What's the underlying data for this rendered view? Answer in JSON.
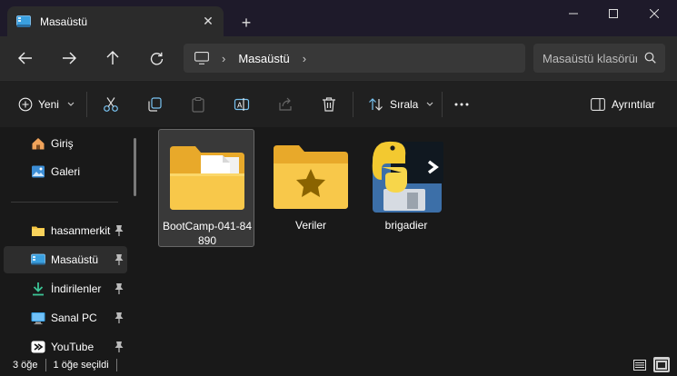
{
  "window": {
    "tab_title": "Masaüstü",
    "tab_close": "✕",
    "new_tab": "+"
  },
  "address": {
    "crumbs": [
      "Masaüstü"
    ]
  },
  "search": {
    "placeholder": "Masaüstü klasörünü ara"
  },
  "toolbar": {
    "new_label": "Yeni",
    "sort_label": "Sırala",
    "details_label": "Ayrıntılar"
  },
  "sidebar": {
    "items": [
      {
        "label": "Giriş",
        "icon": "home-icon"
      },
      {
        "label": "Galeri",
        "icon": "gallery-icon"
      },
      {
        "label": "hasanmerkit",
        "icon": "folder-icon",
        "pinned": true
      },
      {
        "label": "Masaüstü",
        "icon": "desktop-icon",
        "pinned": true,
        "selected": true
      },
      {
        "label": "İndirilenler",
        "icon": "download-icon",
        "pinned": true
      },
      {
        "label": "Sanal PC",
        "icon": "pc-icon",
        "pinned": true
      },
      {
        "label": "YouTube",
        "icon": "youtube-folder-icon",
        "pinned": true
      }
    ]
  },
  "files": [
    {
      "name": "BootCamp-041-84890",
      "icon": "folder-with-file-icon",
      "selected": true
    },
    {
      "name": "Veriler",
      "icon": "star-folder-icon",
      "selected": false
    },
    {
      "name": "brigadier",
      "icon": "python-script-icon",
      "selected": false
    }
  ],
  "status": {
    "item_count": "3 öğe",
    "selected_count": "1 öğe seçildi"
  },
  "colors": {
    "folder": "#f4c542",
    "accent": "#4cc2ff",
    "background": "#191919"
  }
}
